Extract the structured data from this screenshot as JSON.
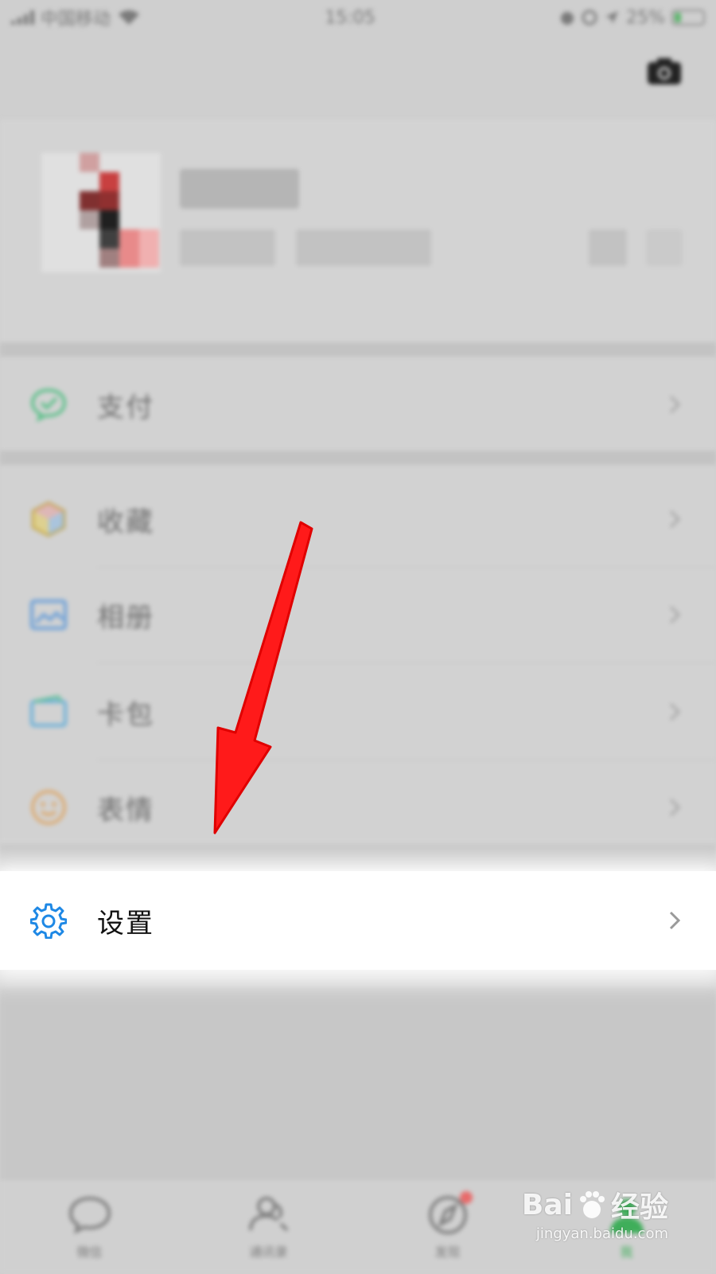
{
  "status_bar": {
    "carrier": "中国移动",
    "time": "15:05",
    "battery": "25%",
    "battery_level": 0.25
  },
  "menu": {
    "pay": {
      "label": "支付",
      "icon": "wechat-pay-icon",
      "color": "#3cb371"
    },
    "favorites": {
      "label": "收藏",
      "icon": "cube-icon"
    },
    "album": {
      "label": "相册",
      "icon": "image-icon",
      "color": "#4a90d9"
    },
    "cards": {
      "label": "卡包",
      "icon": "wallet-icon",
      "color": "#4a90d9"
    },
    "stickers": {
      "label": "表情",
      "icon": "smiley-icon",
      "color": "#e0a060"
    },
    "settings": {
      "label": "设置",
      "icon": "gear-icon",
      "color": "#1e88e5"
    }
  },
  "tabbar": {
    "chats": "微信",
    "contacts": "通讯录",
    "discover": "发现",
    "me": "我"
  },
  "watermark": {
    "brand": "Bai",
    "brand_suffix": "经验",
    "url": "jingyan.baidu.com"
  },
  "colors": {
    "arrow": "#ff1a1a"
  }
}
